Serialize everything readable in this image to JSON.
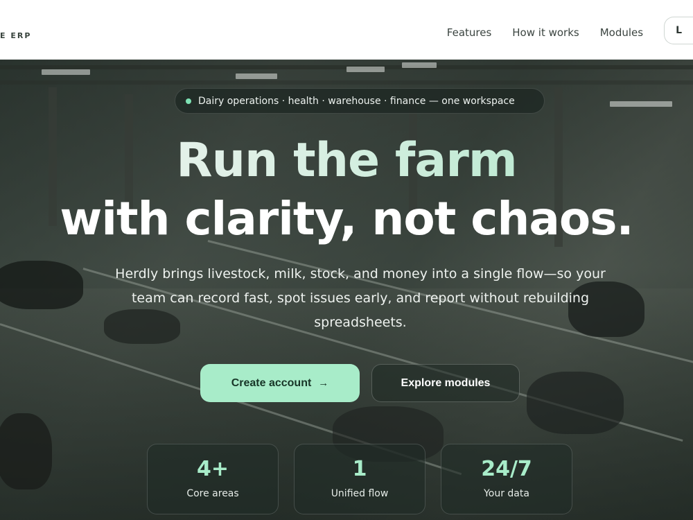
{
  "header": {
    "brand_fragment": "E ERP",
    "nav": [
      {
        "label": "Features"
      },
      {
        "label": "How it works"
      },
      {
        "label": "Modules"
      }
    ],
    "cta_fragment": "L"
  },
  "hero": {
    "tag": "Dairy operations · health · warehouse · finance — one workspace",
    "headline_line1": "Run the farm",
    "headline_line2": "with clarity, not chaos.",
    "subtext": "Herdly brings livestock, milk, stock, and money into a single flow—so your team can record fast, spot issues early, and report without rebuilding spreadsheets.",
    "primary_button": "Create account",
    "primary_button_icon": "arrow-right-icon",
    "secondary_button": "Explore modules",
    "stats": [
      {
        "value": "4+",
        "label": "Core areas"
      },
      {
        "value": "1",
        "label": "Unified flow"
      },
      {
        "value": "24/7",
        "label": "Your data"
      }
    ]
  },
  "colors": {
    "accent": "#a8ecc9",
    "tag_dot": "#7ee2b4",
    "header_bg": "#ffffff"
  }
}
